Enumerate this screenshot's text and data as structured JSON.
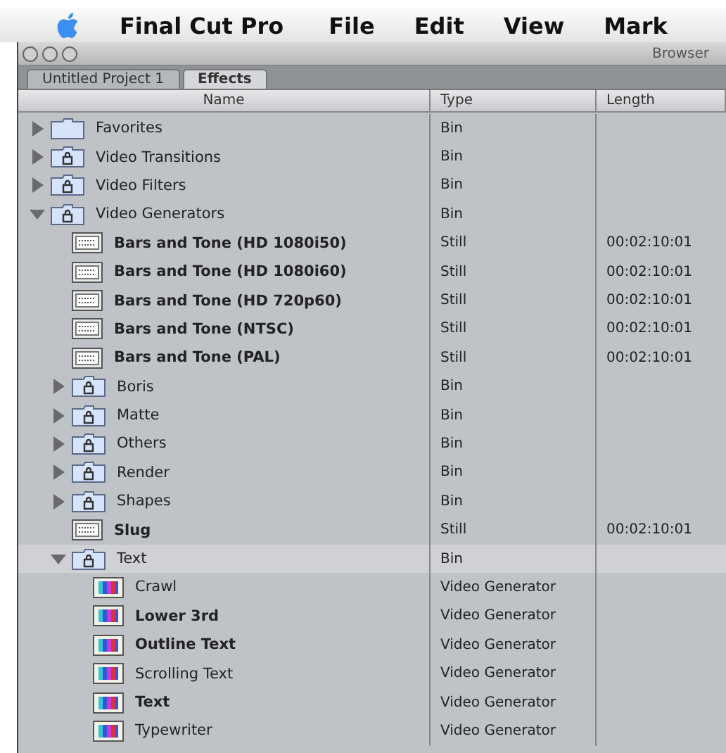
{
  "menu_bar": {
    "items": [
      {
        "label": "Final Cut Pro",
        "kind": "app"
      },
      {
        "label": "File",
        "kind": "menu"
      },
      {
        "label": "Edit",
        "kind": "menu"
      },
      {
        "label": "View",
        "kind": "menu"
      },
      {
        "label": "Mark",
        "kind": "menu"
      }
    ]
  },
  "window": {
    "title": "Browser"
  },
  "tabs": [
    {
      "label": "Untitled Project 1",
      "selected": false
    },
    {
      "label": "Effects",
      "selected": true
    }
  ],
  "table": {
    "columns": [
      "Name",
      "Type",
      "Length"
    ],
    "rows": [
      {
        "name": "Favorites",
        "kind": "folder",
        "type": "Bin",
        "expanded": false,
        "bold": false,
        "selected": false
      },
      {
        "name": "Video Transitions",
        "kind": "bin",
        "type": "Bin",
        "expanded": false,
        "bold": false,
        "selected": false
      },
      {
        "name": "Video Filters",
        "kind": "bin",
        "type": "Bin",
        "expanded": false,
        "bold": false,
        "selected": false
      },
      {
        "name": "Video Generators",
        "kind": "bin",
        "type": "Bin",
        "expanded": true,
        "bold": false,
        "selected": false,
        "children": [
          {
            "name": "Bars and Tone (HD 1080i50)",
            "kind": "still",
            "type": "Still",
            "length": "00:02:10:01",
            "bold": true,
            "selected": false
          },
          {
            "name": "Bars and Tone (HD 1080i60)",
            "kind": "still",
            "type": "Still",
            "length": "00:02:10:01",
            "bold": true,
            "selected": false
          },
          {
            "name": "Bars and Tone (HD 720p60)",
            "kind": "still",
            "type": "Still",
            "length": "00:02:10:01",
            "bold": true,
            "selected": false
          },
          {
            "name": "Bars and Tone (NTSC)",
            "kind": "still",
            "type": "Still",
            "length": "00:02:10:01",
            "bold": true,
            "selected": false
          },
          {
            "name": "Bars and Tone (PAL)",
            "kind": "still",
            "type": "Still",
            "length": "00:02:10:01",
            "bold": true,
            "selected": false
          },
          {
            "name": "Boris",
            "kind": "bin",
            "type": "Bin",
            "expanded": false,
            "bold": false,
            "selected": false
          },
          {
            "name": "Matte",
            "kind": "bin",
            "type": "Bin",
            "expanded": false,
            "bold": false,
            "selected": false
          },
          {
            "name": "Others",
            "kind": "bin",
            "type": "Bin",
            "expanded": false,
            "bold": false,
            "selected": false
          },
          {
            "name": "Render",
            "kind": "bin",
            "type": "Bin",
            "expanded": false,
            "bold": false,
            "selected": false
          },
          {
            "name": "Shapes",
            "kind": "bin",
            "type": "Bin",
            "expanded": false,
            "bold": false,
            "selected": false
          },
          {
            "name": "Slug",
            "kind": "still",
            "type": "Still",
            "length": "00:02:10:01",
            "bold": true,
            "selected": false
          },
          {
            "name": "Text",
            "kind": "bin",
            "type": "Bin",
            "expanded": true,
            "bold": false,
            "selected": true,
            "children": [
              {
                "name": "Crawl",
                "kind": "generator",
                "type": "Video Generator",
                "bold": false,
                "selected": false
              },
              {
                "name": "Lower 3rd",
                "kind": "generator",
                "type": "Video Generator",
                "bold": true,
                "selected": false
              },
              {
                "name": "Outline Text",
                "kind": "generator",
                "type": "Video Generator",
                "bold": true,
                "selected": false
              },
              {
                "name": "Scrolling Text",
                "kind": "generator",
                "type": "Video Generator",
                "bold": false,
                "selected": false
              },
              {
                "name": "Text",
                "kind": "generator",
                "type": "Video Generator",
                "bold": true,
                "selected": false
              },
              {
                "name": "Typewriter",
                "kind": "generator",
                "type": "Video Generator",
                "bold": false,
                "selected": false
              }
            ]
          }
        ]
      }
    ]
  }
}
